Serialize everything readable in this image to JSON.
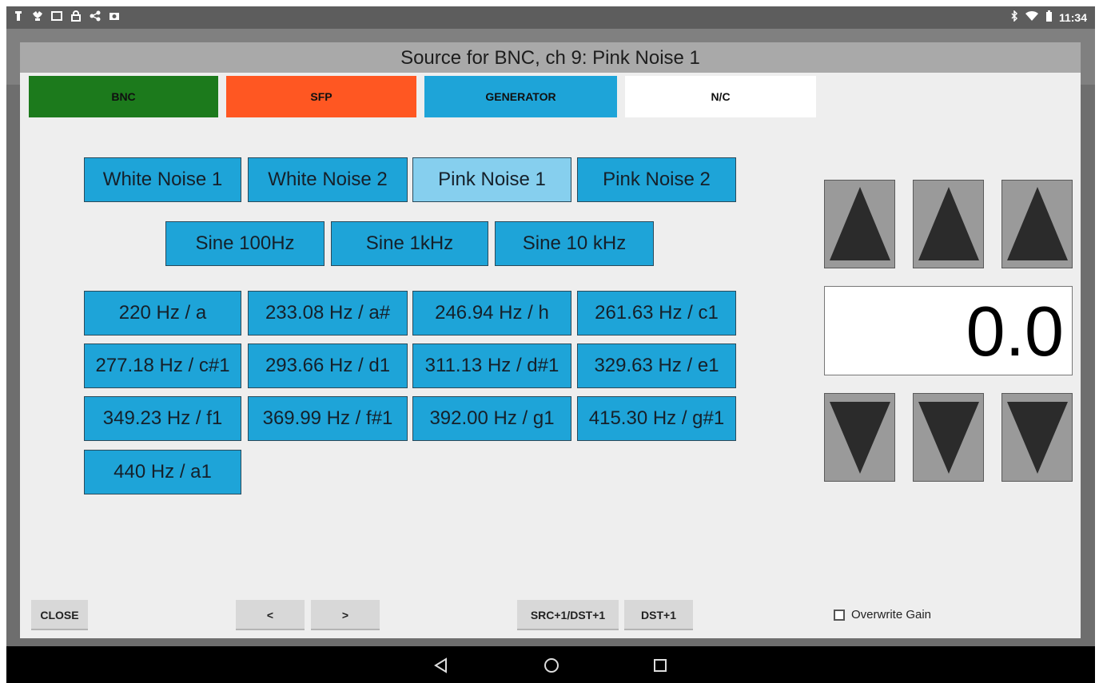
{
  "status_bar": {
    "time": "11:34",
    "left_icons": [
      "usb-icon",
      "dropbox-icon",
      "image-icon",
      "lock-icon",
      "share-icon",
      "photo-icon"
    ],
    "right_icons": [
      "bluetooth-icon",
      "wifi-icon",
      "battery-icon"
    ]
  },
  "dialog": {
    "title": "Source for BNC, ch 9: Pink Noise 1"
  },
  "tabs": [
    {
      "label": "BNC",
      "color": "#1c7a1c"
    },
    {
      "label": "SFP",
      "color": "#ff5722"
    },
    {
      "label": "GENERATOR",
      "color": "#1ea4d8"
    },
    {
      "label": "N/C",
      "color": "#ffffff"
    }
  ],
  "noise_buttons": [
    "White Noise 1",
    "White Noise 2",
    "Pink Noise 1",
    "Pink Noise 2"
  ],
  "selected_source": "Pink Noise 1",
  "sine_buttons": [
    "Sine 100Hz",
    "Sine 1kHz",
    "Sine 10 kHz"
  ],
  "tone_buttons": [
    "220 Hz / a",
    "233.08 Hz / a#",
    "246.94 Hz / h",
    "261.63 Hz / c1",
    "277.18 Hz / c#1",
    "293.66 Hz / d1",
    "311.13 Hz / d#1",
    "329.63 Hz / e1",
    "349.23 Hz / f1",
    "369.99 Hz / f#1",
    "392.00 Hz / g1",
    "415.30 Hz / g#1",
    "440 Hz / a1"
  ],
  "gain": {
    "value": "0.0",
    "up_icons": [
      "triangle-up-icon",
      "triangle-up-icon",
      "triangle-up-icon"
    ],
    "down_icons": [
      "triangle-down-icon",
      "triangle-down-icon",
      "triangle-down-icon"
    ]
  },
  "bottom_bar": {
    "close_label": "CLOSE",
    "prev_label": "<",
    "next_label": ">",
    "src_dst_label": "SRC+1/DST+1",
    "dst_label": "DST+1",
    "overwrite_gain_label": "Overwrite Gain",
    "overwrite_gain_checked": false
  },
  "nav_bar": {
    "icons": [
      "back-icon",
      "home-icon",
      "recents-icon"
    ]
  }
}
